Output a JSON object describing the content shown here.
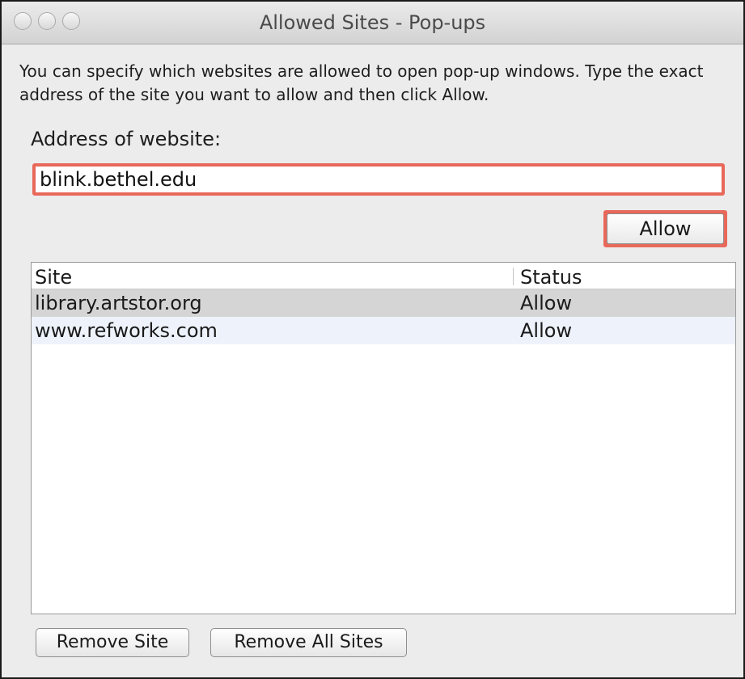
{
  "window": {
    "title": "Allowed Sites - Pop-ups"
  },
  "description": "You can specify which websites are allowed to open pop-up windows. Type the exact address of the site you want to allow and then click Allow.",
  "address": {
    "label": "Address of website:",
    "value": "blink.bethel.edu"
  },
  "allow_button": "Allow",
  "table": {
    "columns": [
      "Site",
      "Status"
    ],
    "rows": [
      {
        "site": "library.artstor.org",
        "status": "Allow"
      },
      {
        "site": "www.refworks.com",
        "status": "Allow"
      }
    ]
  },
  "footer": {
    "remove_site": "Remove Site",
    "remove_all_sites": "Remove All Sites"
  },
  "colors": {
    "highlight": "#e8685a",
    "selected_row": "#d5d5d5",
    "alt_row": "#eef3fb"
  }
}
